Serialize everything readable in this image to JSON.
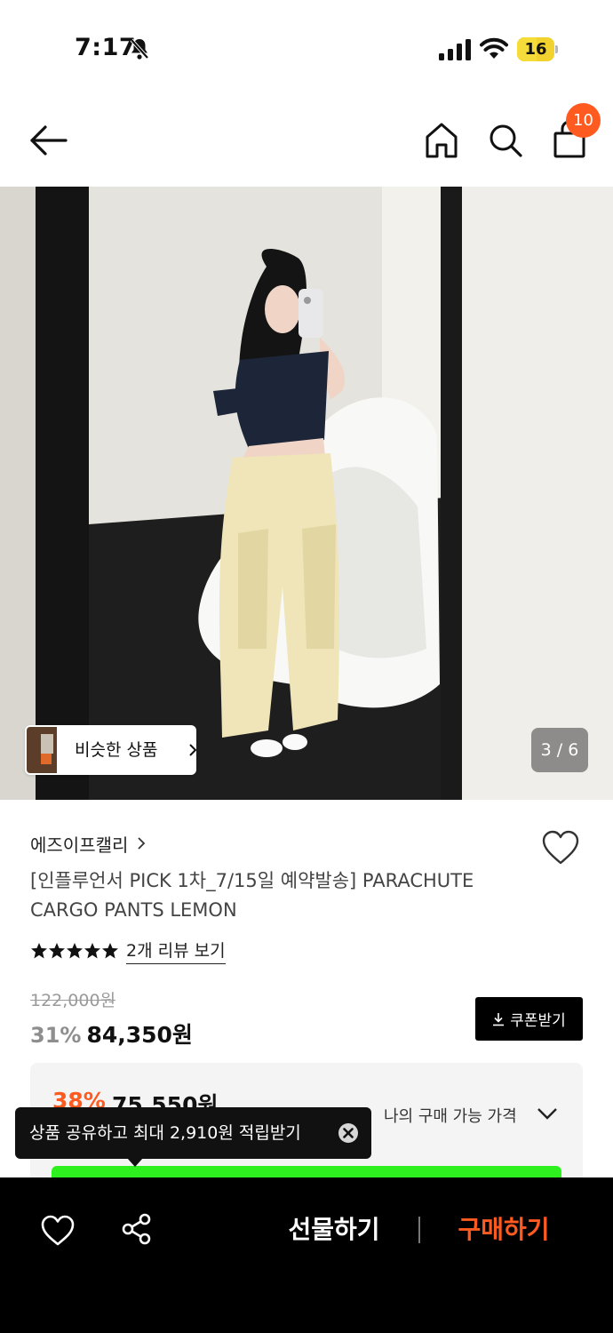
{
  "status_bar": {
    "time": "7:17",
    "battery": "16",
    "icons": [
      "bell-slash-icon",
      "signal-icon",
      "wifi-icon",
      "battery-icon"
    ]
  },
  "top_nav": {
    "cart_count": "10",
    "icons": [
      "back-arrow-icon",
      "home-icon",
      "search-icon",
      "shopping-bag-icon"
    ]
  },
  "gallery": {
    "similar_button_label": "비슷한 상품",
    "page_indicator": "3 / 6"
  },
  "product": {
    "brand": "에즈이프캘리",
    "title": "[인플루언서 PICK 1차_7/15일 예약발송] PARACHUTE CARGO PANTS LEMON",
    "rating_stars": 5,
    "review_link": "2개 리뷰 보기",
    "original_price": "122,000원",
    "discount": "31%",
    "price": "84,350원",
    "coupon_button": "쿠폰받기"
  },
  "my_price": {
    "discount": "38%",
    "price": "75,550원",
    "label": "나의 구매 가능 가격"
  },
  "tooltip": {
    "text": "상품 공유하고 최대 2,910원 적립받기"
  },
  "bottom_bar": {
    "gift_label": "선물하기",
    "buy_label": "구매하기"
  },
  "colors": {
    "accent": "#ff5a1f",
    "black": "#000000",
    "battery": "#f2d22e",
    "progress": "#2ef01e"
  }
}
